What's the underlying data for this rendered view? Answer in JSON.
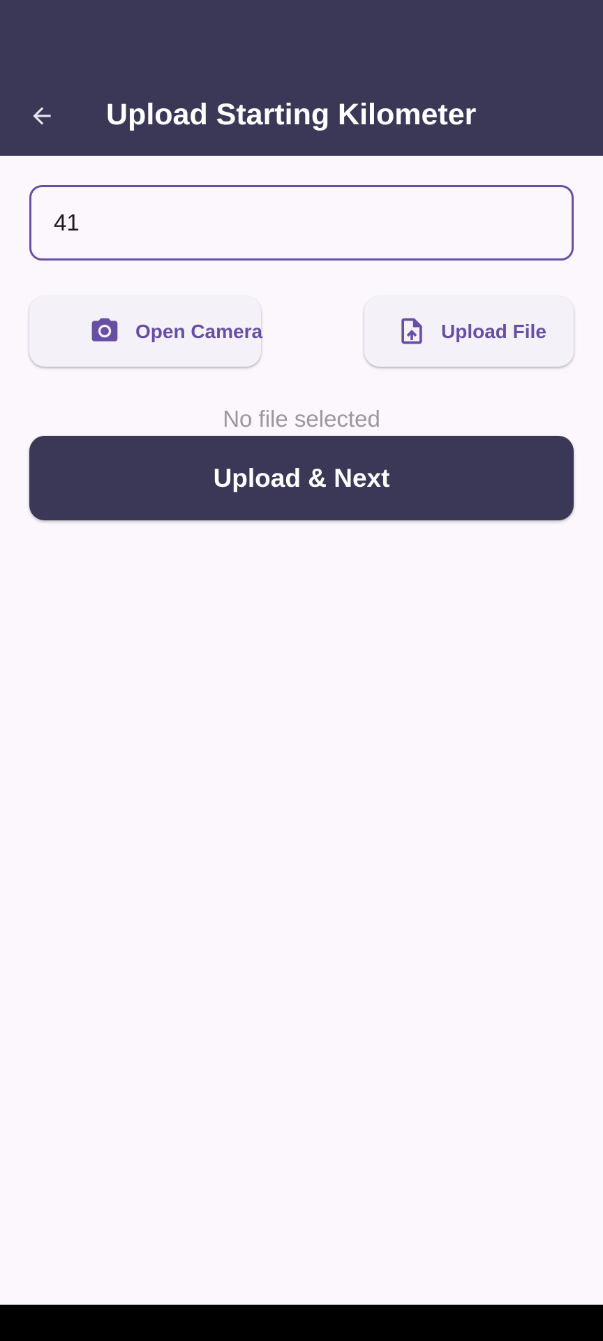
{
  "app_bar": {
    "title": "Upload Starting Kilometer",
    "back_icon": "arrow-back-icon",
    "background": "#3b3857"
  },
  "form": {
    "kilometer_value": "41"
  },
  "actions": {
    "camera": {
      "label": "Open Camera",
      "icon": "camera-icon"
    },
    "file": {
      "label": "Upload File",
      "icon": "file-upload-icon"
    }
  },
  "file_status": "No file selected",
  "submit": {
    "label": "Upload & Next"
  },
  "colors": {
    "accent": "#6750a4",
    "surface": "#fcf6fd",
    "primary_dark": "#3b3857",
    "muted_text": "#9b979d"
  }
}
